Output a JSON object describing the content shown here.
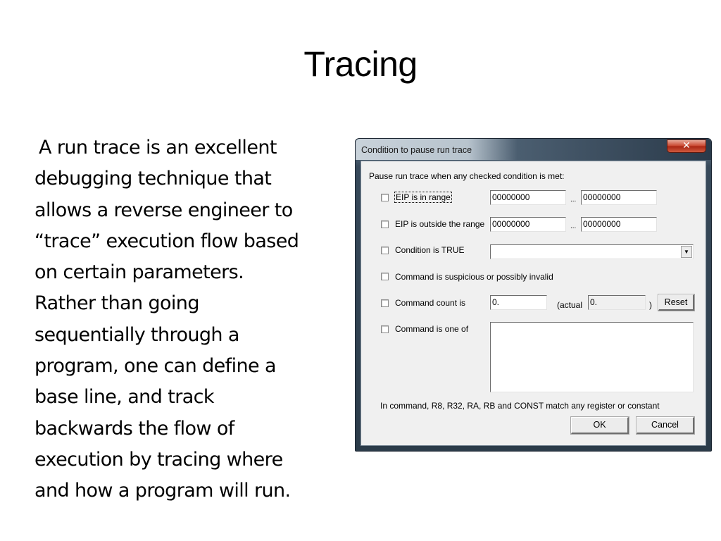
{
  "slide": {
    "title": "Tracing",
    "body_lines": [
      "A run trace is an excellent",
      "debugging technique that",
      "allows a reverse engineer to",
      "“trace” execution flow based",
      "on certain parameters.",
      "Rather than going",
      "sequentially through a",
      "program, one can define a",
      "base line, and track",
      "backwards the flow of",
      "execution by tracing where",
      "and how a program will run."
    ]
  },
  "dialog": {
    "title": "Condition to pause run trace",
    "close_icon": "close-icon",
    "close_glyph": "✕",
    "instruction": "Pause run trace when any checked condition is met:",
    "conditions": {
      "eip_in_range": {
        "label": "EIP is in range",
        "checked": false,
        "from": "00000000",
        "to": "00000000"
      },
      "eip_outside_range": {
        "label": "EIP is outside the range",
        "checked": false,
        "from": "00000000",
        "to": "00000000"
      },
      "condition_true": {
        "label": "Condition is TRUE",
        "checked": false,
        "value": "",
        "dropdown_icon": "▼"
      },
      "suspicious": {
        "label": "Command is suspicious or possibly invalid",
        "checked": false
      },
      "command_count": {
        "label": "Command count is",
        "checked": false,
        "value": "0.",
        "actual_label": "(actual",
        "actual_value": "0.",
        "close_paren": ")",
        "reset_label": "Reset"
      },
      "command_one_of": {
        "label": "Command is one of",
        "checked": false,
        "value": ""
      }
    },
    "range_separator": "...",
    "note": "In command, R8, R32, RA, RB and CONST match any register or constant",
    "ok_label": "OK",
    "cancel_label": "Cancel"
  }
}
